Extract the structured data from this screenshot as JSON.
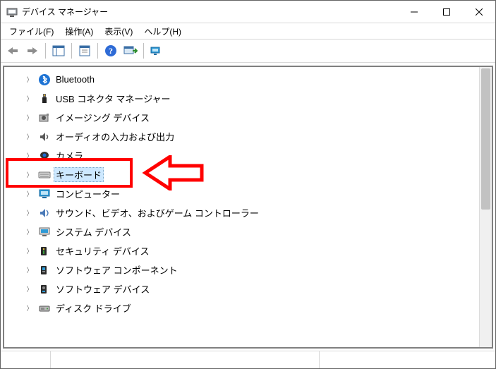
{
  "window": {
    "title": "デバイス マネージャー"
  },
  "menu": {
    "file": "ファイル(F)",
    "action": "操作(A)",
    "view": "表示(V)",
    "help": "ヘルプ(H)"
  },
  "toolbar": {
    "back_icon": "back-arrow",
    "forward_icon": "forward-arrow",
    "properties_icon": "properties",
    "console_icon": "console-tree",
    "help_icon": "help",
    "scan_icon": "scan-hardware",
    "devices_icon": "devices-and-printers"
  },
  "tree": {
    "items": [
      {
        "icon": "bluetooth",
        "label": "Bluetooth",
        "selected": false
      },
      {
        "icon": "usb",
        "label": "USB コネクタ マネージャー",
        "selected": false
      },
      {
        "icon": "imaging",
        "label": "イメージング デバイス",
        "selected": false
      },
      {
        "icon": "audio",
        "label": "オーディオの入力および出力",
        "selected": false
      },
      {
        "icon": "camera",
        "label": "カメラ",
        "selected": false
      },
      {
        "icon": "keyboard",
        "label": "キーボード",
        "selected": true
      },
      {
        "icon": "computer",
        "label": "コンピューター",
        "selected": false
      },
      {
        "icon": "sound",
        "label": "サウンド、ビデオ、およびゲーム コントローラー",
        "selected": false
      },
      {
        "icon": "system",
        "label": "システム デバイス",
        "selected": false
      },
      {
        "icon": "security",
        "label": "セキュリティ デバイス",
        "selected": false
      },
      {
        "icon": "component",
        "label": "ソフトウェア コンポーネント",
        "selected": false
      },
      {
        "icon": "swdev",
        "label": "ソフトウェア デバイス",
        "selected": false
      },
      {
        "icon": "disk",
        "label": "ディスク ドライブ",
        "selected": false
      }
    ]
  },
  "highlight": {
    "target_index": 5
  }
}
